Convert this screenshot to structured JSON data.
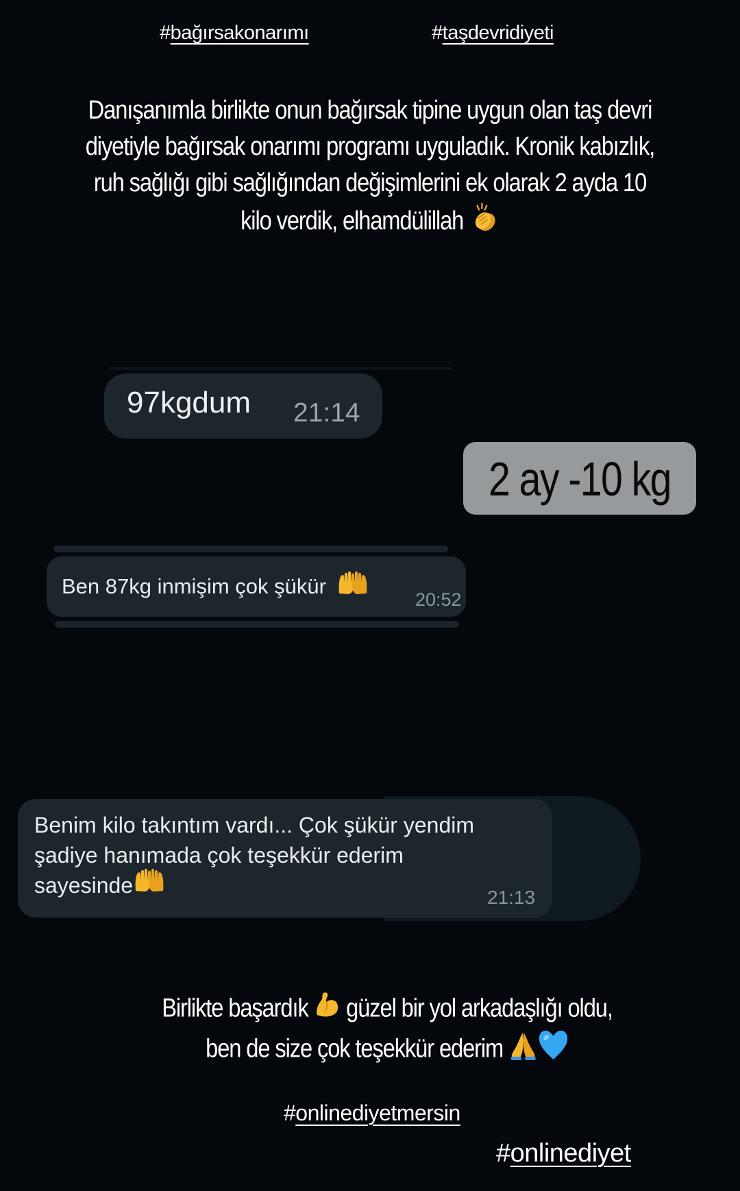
{
  "hashtags": {
    "top_left": "bağırsakonarımı",
    "top_right": "taşdevridiyeti",
    "bottom_center": "onlinediyetmersin",
    "bottom_right": "onlinediyet",
    "prefix": "#"
  },
  "caption": {
    "line1": "Danışanımla birlikte onun bağırsak tipine uygun olan taş devri",
    "line2": "diyetiyle bağırsak onarımı programı uyguladık. Kronik kabızlık,",
    "line3": "ruh sağlığı gibi sağlığından değişimlerini ek olarak 2 ayda 10",
    "line4": "kilo verdik, elhamdülillah"
  },
  "messages": [
    {
      "text": "97kgdum",
      "time": "21:14"
    },
    {
      "text": "Ben 87kg inmişim çok şükür",
      "time": "20:52"
    },
    {
      "line1": "Benim kilo takıntım vardı... Çok şükür yendim",
      "line2": "şadiye hanımada çok teşekkür ederim",
      "line3": "sayesinde",
      "time": "21:13"
    }
  ],
  "sticker": {
    "text": "2 ay -10 kg"
  },
  "closing": {
    "line1_a": "Birlikte başardık",
    "line1_b": "güzel bir yol arkadaşlığı oldu,",
    "line2": "ben de size çok teşekkür ederim"
  },
  "icons": [
    "clapping-hands-icon",
    "palms-up-icon",
    "flexed-biceps-icon",
    "folded-hands-icon",
    "blue-heart-icon"
  ],
  "colors": {
    "background": "#04080d",
    "bubble": "#1d262d",
    "sticker": "#979a9c",
    "emoji_yellow": "#f4b52a",
    "heart_blue": "#35a7f2"
  }
}
